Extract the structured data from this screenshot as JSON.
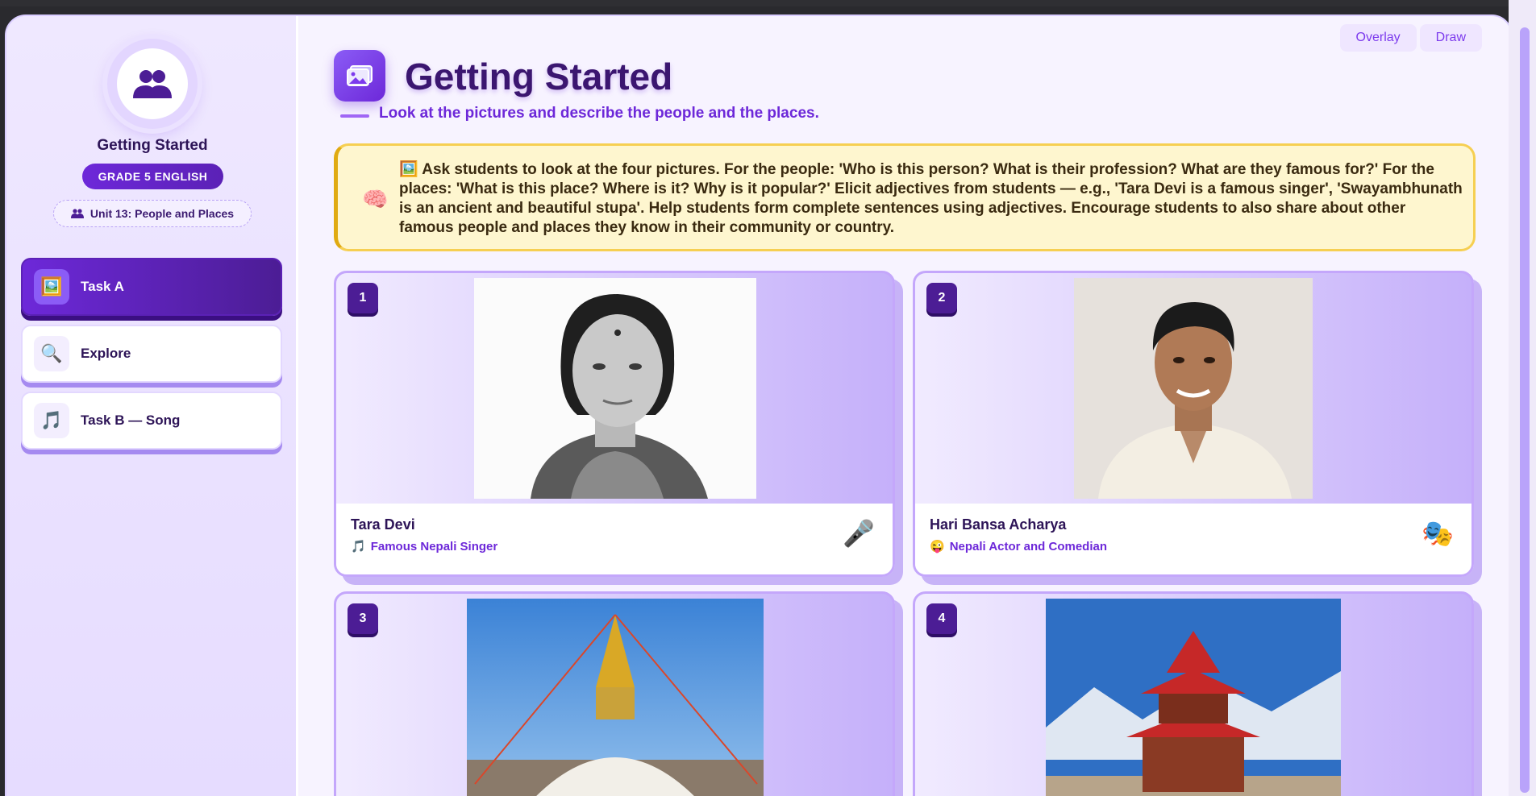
{
  "top_tabs": [
    {
      "label": "Overlay"
    },
    {
      "label": "Draw"
    }
  ],
  "sidebar": {
    "title": "Getting Started",
    "grade": "GRADE 5 ENGLISH",
    "unit": "Unit 13: People and Places",
    "items": [
      {
        "label": "Task A",
        "icon": "picture-icon",
        "active": true
      },
      {
        "label": "Explore",
        "icon": "magnifier-icon",
        "active": false
      },
      {
        "label": "Task B — Song",
        "icon": "music-note-icon",
        "active": false
      }
    ]
  },
  "main": {
    "title": "Getting Started",
    "subtitle": "Look at the pictures and describe the people and the places.",
    "note": "🖼️ Ask students to look at the four pictures. For the people: 'Who is this person? What is their profession? What are they famous for?' For the places: 'What is this place? Where is it? Why is it popular?' Elicit adjectives from students — e.g., 'Tara Devi is a famous singer', 'Swayambhunath is an ancient and beautiful stupa'. Help students form complete sentences using adjectives. Encourage students to also share about other famous people and places they know in their community or country.",
    "cards": [
      {
        "number": "1",
        "name": "Tara Devi",
        "role": "Famous Nepali Singer",
        "role_icon": "🎵",
        "emoji": "🎤"
      },
      {
        "number": "2",
        "name": "Hari Bansa Acharya",
        "role": "Nepali Actor and Comedian",
        "role_icon": "😜",
        "emoji": "🎭"
      },
      {
        "number": "3"
      },
      {
        "number": "4"
      }
    ]
  },
  "colors": {
    "accent": "#6d28d9",
    "note_bg": "#fef6cf",
    "note_border": "#f6cf52"
  }
}
